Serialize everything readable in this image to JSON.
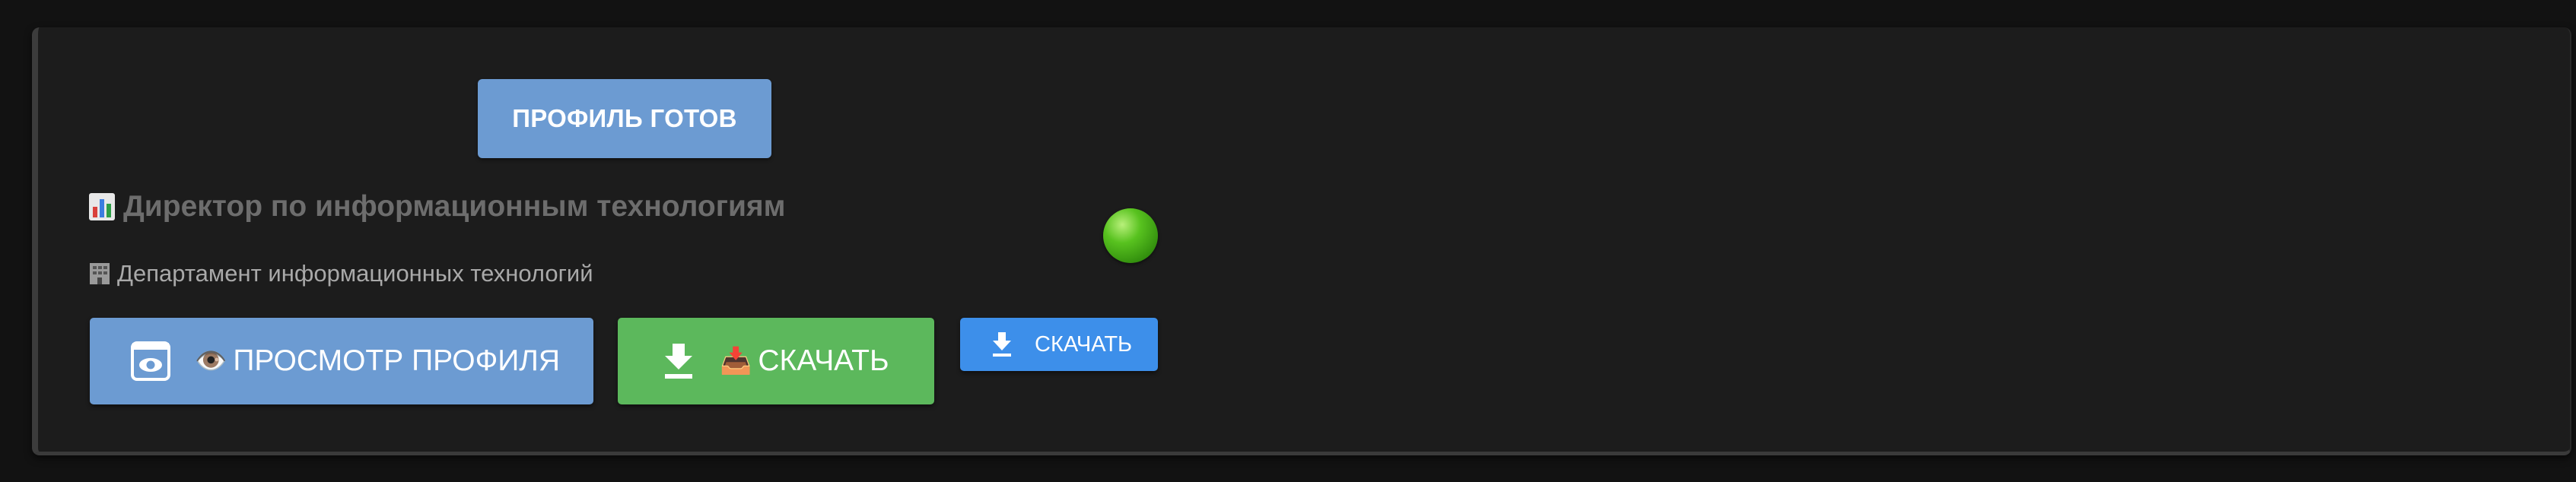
{
  "status_badge": {
    "label": "ПРОФИЛЬ ГОТОВ"
  },
  "profile": {
    "title": "Директор по информационным технологиям",
    "title_icon": "bar-chart-emoji-icon",
    "department": "Департамент информационных технологий",
    "department_icon": "office-building-emoji-icon",
    "status_indicator_color": "#4caf1a"
  },
  "actions": {
    "view_profile": {
      "emoji": "👁️",
      "label": "ПРОСМОТР ПРОФИЛЯ",
      "icon": "preview-icon",
      "color": "#6c9bd2"
    },
    "download": {
      "emoji": "📥",
      "label": "СКАЧАТЬ",
      "icon": "download-icon",
      "color": "#5cb85c"
    },
    "download_small": {
      "label": "СКАЧАТЬ",
      "icon": "download-icon",
      "color": "#3d8fea"
    }
  },
  "colors": {
    "background": "#121212",
    "card": "#1c1c1c"
  }
}
